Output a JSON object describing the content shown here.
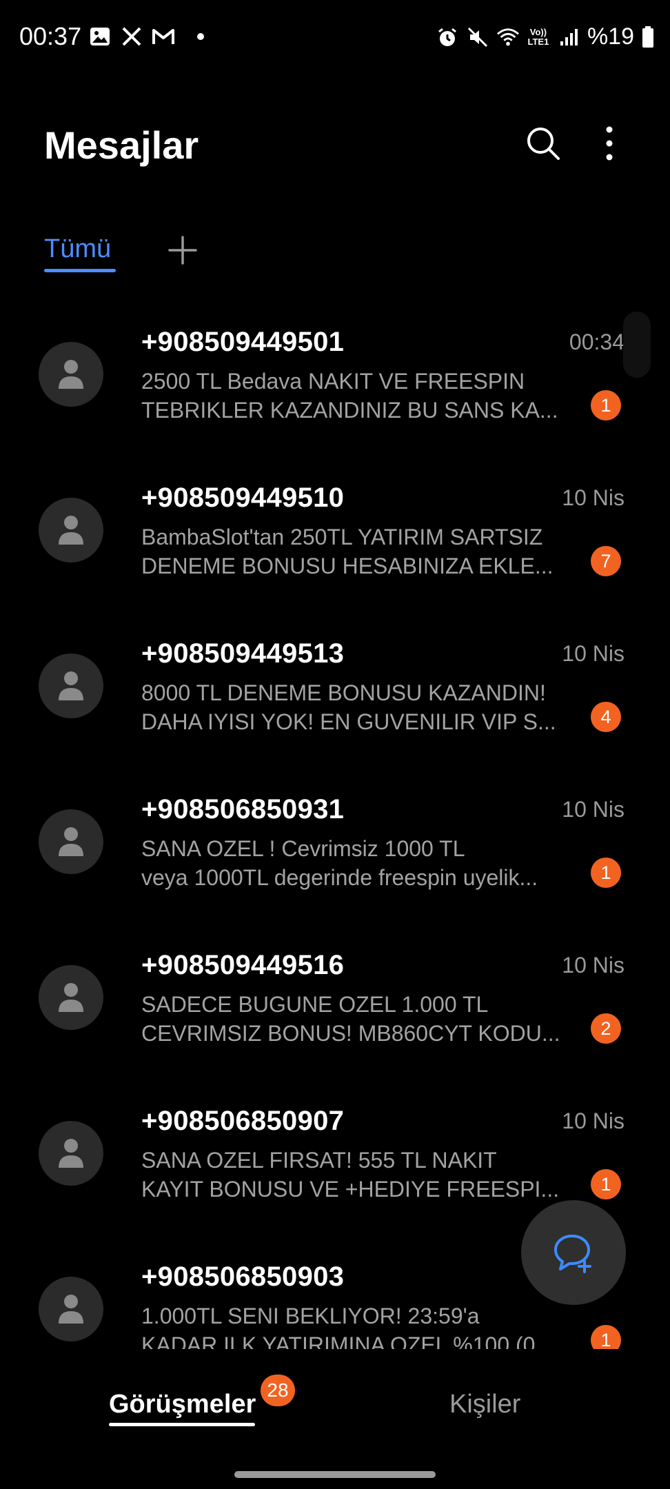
{
  "status_bar": {
    "time": "00:37",
    "left_icons": [
      "gallery-icon",
      "x-icon",
      "gmail-icon"
    ],
    "right_icons": [
      "alarm-icon",
      "mute-icon",
      "wifi-icon",
      "lte-icon",
      "signal-icon"
    ],
    "lte_top": "Vo))",
    "lte_bottom": "LTE1",
    "battery": "%19"
  },
  "header": {
    "title": "Mesajlar"
  },
  "tabs": {
    "all_label": "Tümü"
  },
  "conversations": [
    {
      "sender": "+908509449501",
      "date": "00:34",
      "line1": "2500 TL Bedava NAKIT VE FREESPIN",
      "line2": "TEBRIKLER KAZANDINIZ  BU SANS KA...",
      "unread": "1"
    },
    {
      "sender": "+908509449510",
      "date": "10 Nis",
      "line1": "BambaSlot'tan 250TL YATIRIM SARTSIZ",
      "line2": "DENEME BONUSU HESABINIZA EKLE...",
      "unread": "7"
    },
    {
      "sender": "+908509449513",
      "date": "10 Nis",
      "line1": "8000 TL DENEME BONUSU KAZANDIN!",
      "line2": "DAHA IYISI YOK!  EN GUVENILIR VIP S...",
      "unread": "4"
    },
    {
      "sender": "+908506850931",
      "date": "10 Nis",
      "line1": "SANA OZEL ! Cevrimsiz 1000 TL",
      "line2": "veya 1000TL degerinde freespin uyelik...",
      "unread": "1"
    },
    {
      "sender": "+908509449516",
      "date": "10 Nis",
      "line1": "SADECE BUGUNE OZEL 1.000 TL",
      "line2": "CEVRIMSIZ BONUS! MB860CYT KODU...",
      "unread": "2"
    },
    {
      "sender": "+908506850907",
      "date": "10 Nis",
      "line1": "SANA OZEL FIRSAT! 555 TL NAKIT",
      "line2": "KAYIT BONUSU VE +HEDIYE FREESPI...",
      "unread": "1"
    },
    {
      "sender": "+908506850903",
      "date": "",
      "line1": "1.000TL SENI BEKLIYOR! 23:59'a",
      "line2": "KADAR ILK YATIRIMINA OZEL %100 (0...",
      "unread": "1"
    }
  ],
  "bottom_nav": {
    "conversations_label": "Görüşmeler",
    "conversations_badge": "28",
    "contacts_label": "Kişiler"
  },
  "colors": {
    "accent": "#4d8dff",
    "badge": "#f26322",
    "background": "#000000"
  }
}
